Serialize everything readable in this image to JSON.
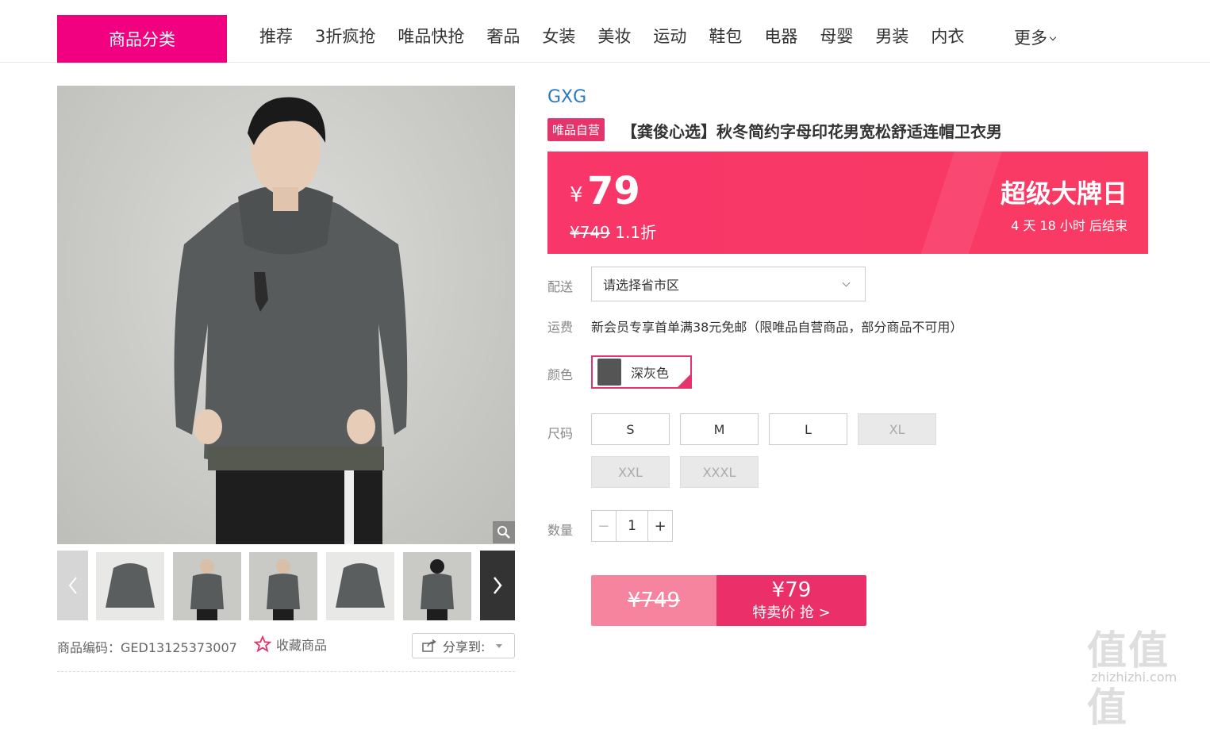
{
  "nav": {
    "category_button": "商品分类",
    "links": [
      "推荐",
      "3折疯抢",
      "唯品快抢",
      "奢品",
      "女装",
      "美妆",
      "运动",
      "鞋包",
      "电器",
      "母婴",
      "男装",
      "内衣"
    ],
    "more": "更多"
  },
  "gallery": {
    "product_code": "商品编码：GED13125373007",
    "favorite": "收藏商品",
    "share": "分享到:"
  },
  "product": {
    "brand": "GXG",
    "badge": "唯品自营",
    "title": "【龚俊心选】秋冬简约字母印花男宽松舒适连帽卫衣男",
    "price_symbol": "¥",
    "price": "79",
    "original_price": "¥749",
    "discount": "1.1折",
    "event_name": "超级大牌日",
    "countdown": "4 天 18 小时 后结束"
  },
  "options": {
    "delivery_label": "配送",
    "delivery_placeholder": "请选择省市区",
    "fee_label": "运费",
    "fee_text": "新会员专享首单满38元免邮（限唯品自营商品，部分商品不可用）",
    "color_label": "颜色",
    "color_value": "深灰色",
    "size_label": "尺码",
    "sizes": [
      "S",
      "M",
      "L",
      "XL",
      "XXL",
      "XXXL"
    ],
    "qty_label": "数量",
    "qty": "1"
  },
  "buy": {
    "orig": "¥749",
    "price": "¥79",
    "label": "特卖价 抢 >"
  },
  "watermark": {
    "logo": "值值值",
    "site": "zhizhizhi.com"
  },
  "colors": {
    "brand_pink": "#f10180",
    "price_red": "#f93b63",
    "accent": "#e5346b"
  }
}
